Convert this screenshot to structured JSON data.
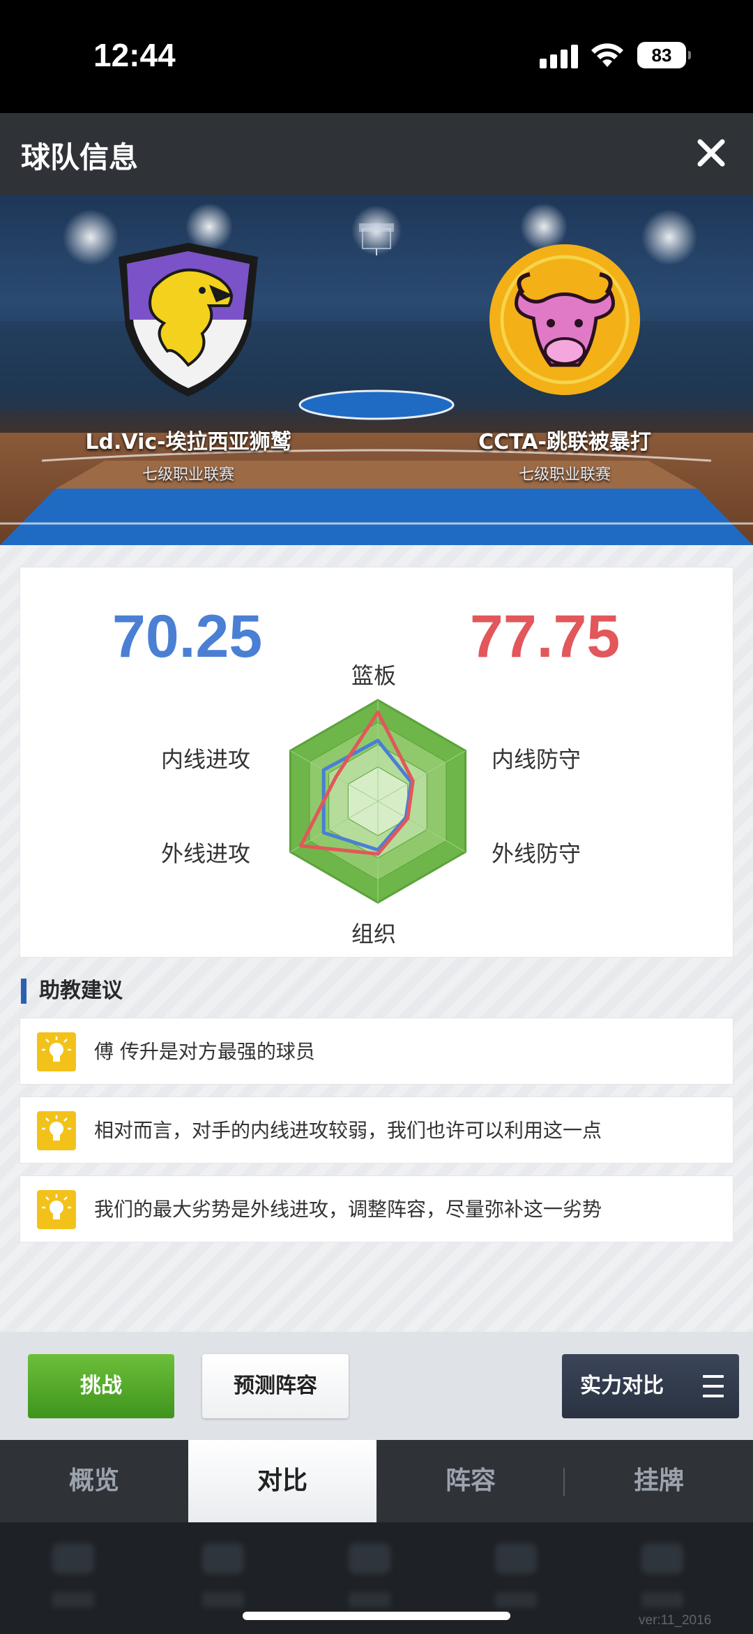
{
  "status_bar": {
    "time": "12:44",
    "battery": "83",
    "icons": [
      "signal-icon",
      "wifi-icon",
      "battery-icon"
    ]
  },
  "header": {
    "title": "球队信息",
    "close_icon": "close-icon"
  },
  "teams": {
    "left": {
      "name": "Ld.Vic-埃拉西亚狮鹫",
      "league": "七级职业联赛",
      "logo": "griffin-shield-logo"
    },
    "right": {
      "name": "CCTA-跳联被暴打",
      "league": "七级职业联赛",
      "logo": "bull-badge-logo"
    }
  },
  "comparison": {
    "left_score": "70.25",
    "right_score": "77.75",
    "left_color": "#4a7fd4",
    "right_color": "#e2575a",
    "axes": [
      "篮板",
      "内线防守",
      "外线防守",
      "组织",
      "外线进攻",
      "内线进攻"
    ],
    "left_values": [
      0.6,
      0.38,
      0.32,
      0.48,
      0.62,
      0.62
    ],
    "right_values": [
      0.88,
      0.4,
      0.34,
      0.52,
      0.88,
      0.48
    ]
  },
  "advice": {
    "title": "助教建议",
    "icon": "lightbulb-icon",
    "tips": [
      "傅 传升是对方最强的球员",
      "相对而言，对手的内线进攻较弱，我们也许可以利用这一点",
      "我们的最大劣势是外线进攻，调整阵容，尽量弥补这一劣势"
    ]
  },
  "actions": {
    "challenge": "挑战",
    "predict": "预测阵容",
    "compare": "实力对比",
    "compare_icon": "menu-icon"
  },
  "tabs": [
    "概览",
    "对比",
    "阵容",
    "挂牌"
  ],
  "active_tab": "对比",
  "version": "ver:11_2016"
}
